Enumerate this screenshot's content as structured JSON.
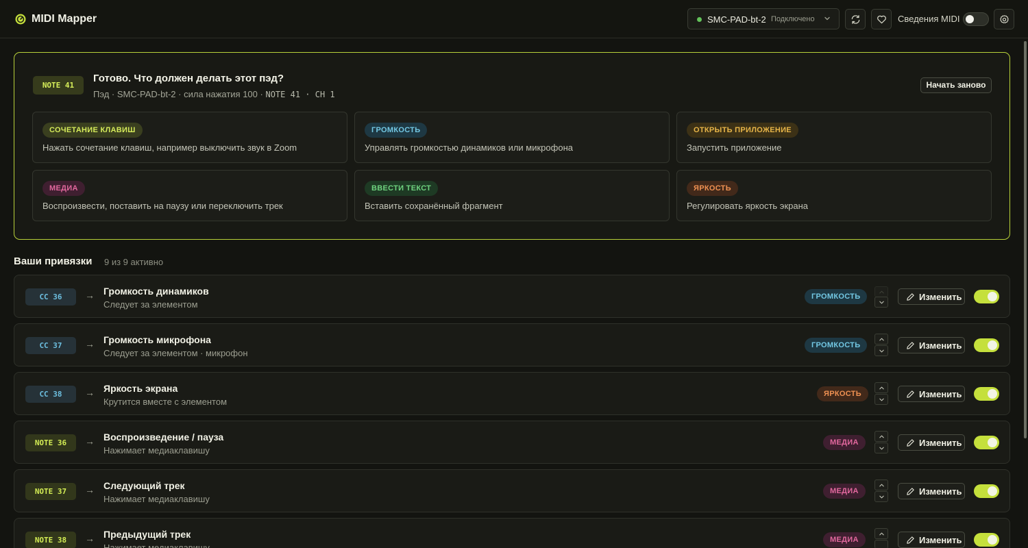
{
  "header": {
    "app_title": "MIDI Mapper",
    "device_name": "SMC-PAD-bt-2",
    "device_status": "Подключено",
    "midi_info_label": "Сведения MIDI",
    "icons": [
      "refresh-icon",
      "heart-icon",
      "gear-icon",
      "chevron-down-icon"
    ]
  },
  "panel": {
    "note_chip": "NOTE 41",
    "title": "Готово. Что должен делать этот пэд?",
    "subtitle_text": "Пэд · SMC-PAD-bt-2 · сила нажатия 100 ·",
    "subtitle_code": "NOTE 41 · CH 1",
    "restart_label": "Начать заново",
    "actions": [
      {
        "tag": "СОЧЕТАНИЕ КЛАВИШ",
        "desc": "Нажать сочетание клавиш, например выключить звук в Zoom",
        "color": "#d4ea5a"
      },
      {
        "tag": "ГРОМКОСТЬ",
        "desc": "Управлять громкостью динамиков или микрофона",
        "color": "#73c8e4"
      },
      {
        "tag": "ОТКРЫТЬ ПРИЛОЖЕНИЕ",
        "desc": "Запустить приложение",
        "color": "#e7b548"
      },
      {
        "tag": "МЕДИА",
        "desc": "Воспроизвести, поставить на паузу или переключить трек",
        "color": "#e2689e"
      },
      {
        "tag": "ВВЕСТИ ТЕКСТ",
        "desc": "Вставить сохранённый фрагмент",
        "color": "#6fd27f"
      },
      {
        "tag": "ЯРКОСТЬ",
        "desc": "Регулировать яркость экрана",
        "color": "#ef9152"
      }
    ]
  },
  "bindings_section": {
    "title": "Ваши привязки",
    "count": "9 из 9 активно"
  },
  "bindings": [
    {
      "source": "CC 36",
      "title": "Громкость динамиков",
      "subtitle": "Следует за элементом",
      "tag": "ГРОМКОСТЬ",
      "edit_label": "Изменить",
      "enabled": true
    },
    {
      "source": "CC 37",
      "title": "Громкость микрофона",
      "subtitle": "Следует за элементом · микрофон",
      "tag": "ГРОМКОСТЬ",
      "edit_label": "Изменить",
      "enabled": true
    },
    {
      "source": "CC 38",
      "title": "Яркость экрана",
      "subtitle": "Крутится вместе с элементом",
      "tag": "ЯРКОСТЬ",
      "edit_label": "Изменить",
      "enabled": true
    },
    {
      "source": "NOTE 36",
      "title": "Воспроизведение / пауза",
      "subtitle": "Нажимает медиаклавишу",
      "tag": "МЕДИА",
      "edit_label": "Изменить",
      "enabled": true
    },
    {
      "source": "NOTE 37",
      "title": "Следующий трек",
      "subtitle": "Нажимает медиаклавишу",
      "tag": "МЕДИА",
      "edit_label": "Изменить",
      "enabled": true
    },
    {
      "source": "NOTE 38",
      "title": "Предыдущий трек",
      "subtitle": "Нажимает медиаклавишу",
      "tag": "МЕДИА",
      "edit_label": "Изменить",
      "enabled": true
    }
  ],
  "colors": {
    "accent": "#c5e03c",
    "background": "#131410",
    "connected": "#63c25a"
  }
}
